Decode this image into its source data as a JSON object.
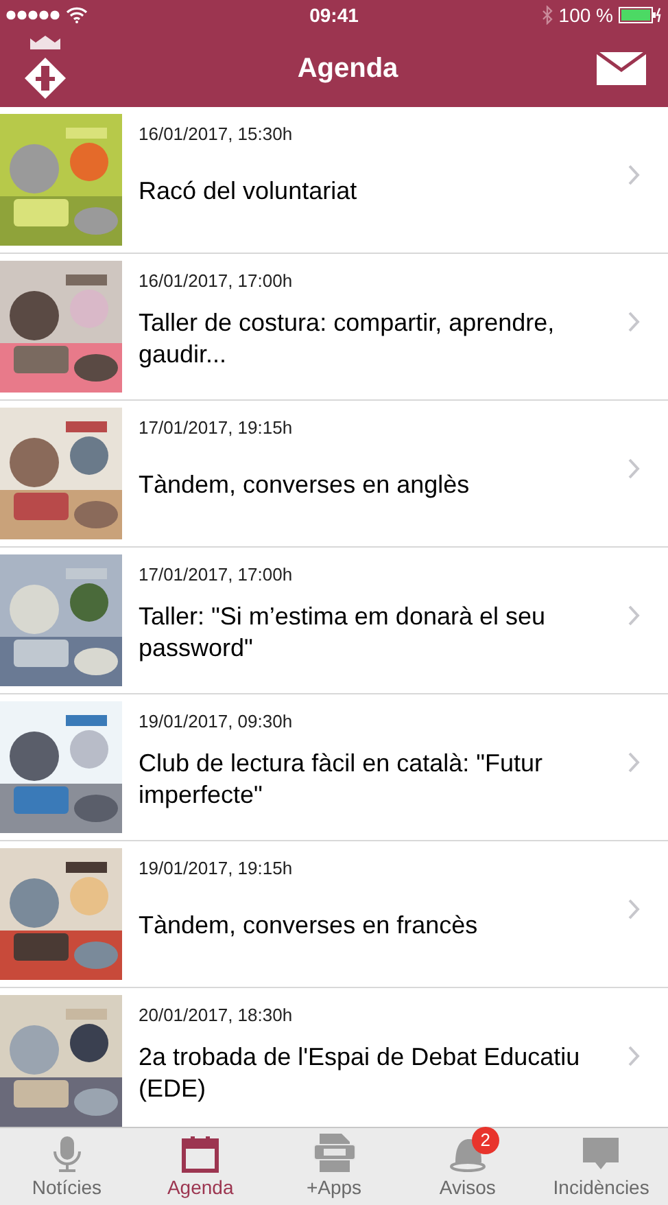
{
  "status_bar": {
    "time": "09:41",
    "battery": "100 %"
  },
  "header": {
    "title": "Agenda"
  },
  "events": [
    {
      "date": "16/01/2017, 15:30h",
      "title": "Racó del voluntariat"
    },
    {
      "date": "16/01/2017, 17:00h",
      "title": "Taller de costura: compartir, aprendre, gaudir..."
    },
    {
      "date": "17/01/2017, 19:15h",
      "title": "Tàndem, converses en anglès"
    },
    {
      "date": "17/01/2017, 17:00h",
      "title": "Taller: \"Si m’estima em donarà el seu password\""
    },
    {
      "date": "19/01/2017, 09:30h",
      "title": "Club de lectura fàcil en català: \"Futur imperfecte\""
    },
    {
      "date": "19/01/2017, 19:15h",
      "title": "Tàndem, converses en francès"
    },
    {
      "date": "20/01/2017, 18:30h",
      "title": "2a trobada de l'Espai de Debat Educatiu (EDE)"
    }
  ],
  "tab_bar": [
    {
      "kind": "mic",
      "label": "Notícies",
      "selected": false
    },
    {
      "kind": "calendar",
      "label": "Agenda",
      "selected": true
    },
    {
      "kind": "app",
      "label": "+Apps",
      "selected": false
    },
    {
      "kind": "bell",
      "label": "Avisos",
      "selected": false,
      "badge": "2"
    },
    {
      "kind": "chat",
      "label": "Incidències",
      "selected": false
    }
  ]
}
